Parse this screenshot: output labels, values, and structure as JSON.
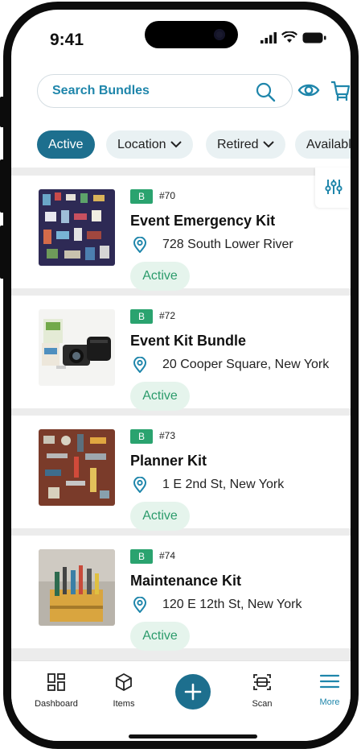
{
  "status_bar": {
    "time": "9:41"
  },
  "search": {
    "placeholder": "Search Bundles"
  },
  "filters": [
    {
      "label": "Active",
      "active": true
    },
    {
      "label": "Location",
      "dropdown": true
    },
    {
      "label": "Retired",
      "dropdown": true
    },
    {
      "label": "Available",
      "dropdown": false
    }
  ],
  "bundles": [
    {
      "badge": "B",
      "number": "#70",
      "title": "Event Emergency Kit",
      "address": "728 South Lower River",
      "status": "Active"
    },
    {
      "badge": "B",
      "number": "#72",
      "title": "Event Kit Bundle",
      "address": "20 Cooper Square, New York",
      "status": "Active"
    },
    {
      "badge": "B",
      "number": "#73",
      "title": "Planner Kit",
      "address": "1 E 2nd St, New York",
      "status": "Active"
    },
    {
      "badge": "B",
      "number": "#74",
      "title": "Maintenance Kit",
      "address": "120 E 12th St, New York",
      "status": "Active"
    }
  ],
  "nav": {
    "dashboard": "Dashboard",
    "items": "Items",
    "scan": "Scan",
    "more": "More"
  },
  "colors": {
    "accent": "#1d6f8e",
    "link": "#1f86ab",
    "badge": "#2aa36f",
    "status": "#2b9b6b"
  }
}
